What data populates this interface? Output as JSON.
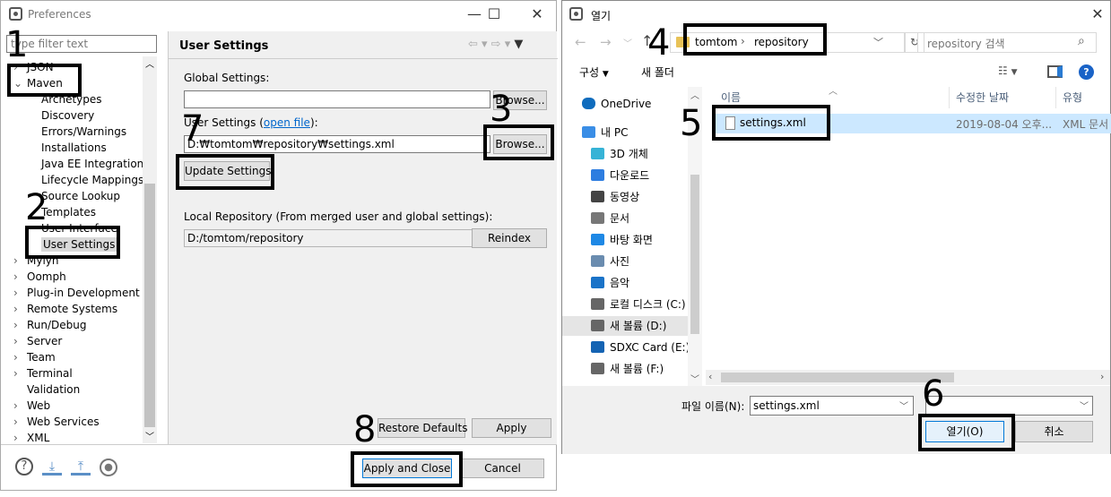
{
  "preferences": {
    "title": "Preferences",
    "filter_placeholder": "type filter text",
    "tree": [
      {
        "label": "JSON",
        "level": 0,
        "arrow": "›"
      },
      {
        "label": "Maven",
        "level": 0,
        "arrow": "⌄"
      },
      {
        "label": "Archetypes",
        "level": 1
      },
      {
        "label": "Discovery",
        "level": 1
      },
      {
        "label": "Errors/Warnings",
        "level": 1
      },
      {
        "label": "Installations",
        "level": 1
      },
      {
        "label": "Java EE Integration",
        "level": 1
      },
      {
        "label": "Lifecycle Mappings",
        "level": 1
      },
      {
        "label": "Source Lookup",
        "level": 1
      },
      {
        "label": "Templates",
        "level": 1
      },
      {
        "label": "User Interface",
        "level": 1
      },
      {
        "label": "User Settings",
        "level": 1,
        "selected": true
      },
      {
        "label": "Mylyn",
        "level": 0,
        "arrow": "›"
      },
      {
        "label": "Oomph",
        "level": 0,
        "arrow": "›"
      },
      {
        "label": "Plug-in Development",
        "level": 0,
        "arrow": "›"
      },
      {
        "label": "Remote Systems",
        "level": 0,
        "arrow": "›"
      },
      {
        "label": "Run/Debug",
        "level": 0,
        "arrow": "›"
      },
      {
        "label": "Server",
        "level": 0,
        "arrow": "›"
      },
      {
        "label": "Team",
        "level": 0,
        "arrow": "›"
      },
      {
        "label": "Terminal",
        "level": 0,
        "arrow": "›"
      },
      {
        "label": "Validation",
        "level": 0
      },
      {
        "label": "Web",
        "level": 0,
        "arrow": "›"
      },
      {
        "label": "Web Services",
        "level": 0,
        "arrow": "›"
      },
      {
        "label": "XML",
        "level": 0,
        "arrow": "›"
      }
    ],
    "panel_title": "User Settings",
    "global_settings_label": "Global Settings:",
    "global_settings_value": "",
    "browse_label": "Browse...",
    "user_settings_label": "User Settings (",
    "open_file_link": "open file",
    "user_settings_label_end": "):",
    "user_settings_value": "D:₩tomtom₩repository₩settings.xml",
    "update_settings": "Update Settings",
    "local_repo_label": "Local Repository (From merged user and global settings):",
    "local_repo_value": "D:/tomtom/repository",
    "reindex": "Reindex",
    "restore_defaults": "Restore Defaults",
    "apply": "Apply",
    "apply_close": "Apply and Close",
    "cancel": "Cancel"
  },
  "open_dialog": {
    "title": "열기",
    "breadcrumb": [
      "tomtom",
      "repository"
    ],
    "search_placeholder": "repository 검색",
    "organize": "구성",
    "new_folder": "새 폴더",
    "nav": [
      {
        "label": "OneDrive",
        "icon": "cloud-icon",
        "color": "#0f6cbd"
      },
      {
        "label": "내 PC",
        "icon": "computer-icon",
        "color": "#3a8ee6"
      },
      {
        "label": "3D 개체",
        "icon": "cube-icon",
        "color": "#36b3d6"
      },
      {
        "label": "다운로드",
        "icon": "download-icon",
        "color": "#2d7de0"
      },
      {
        "label": "동영상",
        "icon": "video-icon",
        "color": "#444"
      },
      {
        "label": "문서",
        "icon": "document-icon",
        "color": "#777"
      },
      {
        "label": "바탕 화면",
        "icon": "desktop-icon",
        "color": "#1e88e5"
      },
      {
        "label": "사진",
        "icon": "picture-icon",
        "color": "#6a8caf"
      },
      {
        "label": "음악",
        "icon": "music-icon",
        "color": "#1a73c8"
      },
      {
        "label": "로컬 디스크 (C:)",
        "icon": "drive-icon",
        "color": "#666"
      },
      {
        "label": "새 볼륨 (D:)",
        "icon": "drive-icon",
        "color": "#666",
        "selected": true
      },
      {
        "label": "SDXC Card (E:)",
        "icon": "sdcard-icon",
        "color": "#1463b3"
      },
      {
        "label": "새 볼륨 (F:)",
        "icon": "drive-icon",
        "color": "#666"
      }
    ],
    "columns": {
      "name": "이름",
      "date": "수정한 날짜",
      "type": "유형"
    },
    "files": [
      {
        "name": "settings.xml",
        "date": "2019-08-04 오후...",
        "type": "XML 문서"
      }
    ],
    "filename_label": "파일 이름(N):",
    "filename_value": "settings.xml",
    "open_button": "열기(O)",
    "cancel_button": "취소"
  },
  "annotations": [
    "1",
    "2",
    "3",
    "4",
    "5",
    "6",
    "7",
    "8"
  ]
}
